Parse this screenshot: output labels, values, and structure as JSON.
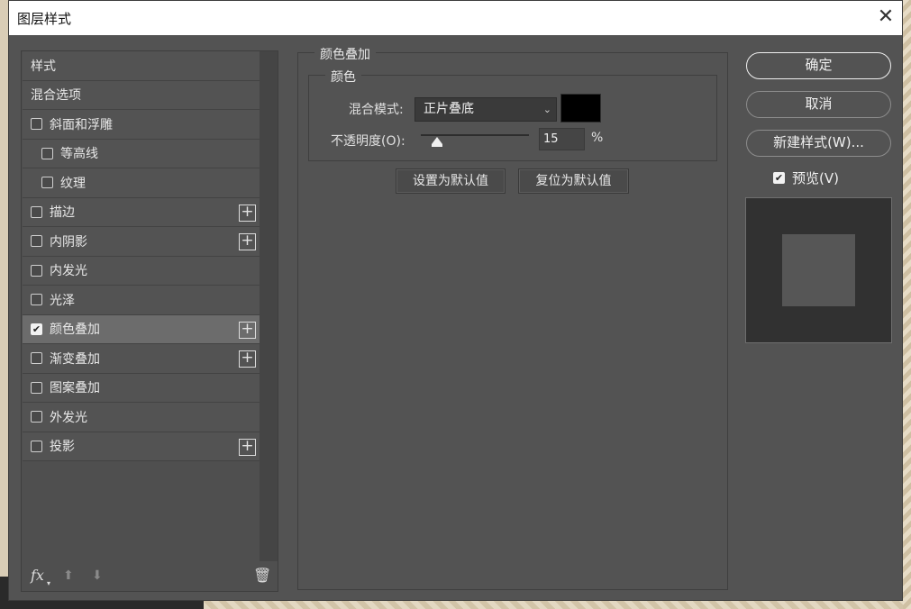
{
  "window": {
    "title": "图层样式",
    "close_glyph": "✕"
  },
  "style_list": [
    {
      "label": "样式",
      "checkbox": false,
      "level": 0,
      "plus": false,
      "active": false
    },
    {
      "label": "混合选项",
      "checkbox": false,
      "level": 0,
      "plus": false,
      "active": false
    },
    {
      "label": "斜面和浮雕",
      "checkbox": true,
      "checked": false,
      "level": 0,
      "plus": false,
      "active": false
    },
    {
      "label": "等高线",
      "checkbox": true,
      "checked": false,
      "level": 1,
      "plus": false,
      "active": false
    },
    {
      "label": "纹理",
      "checkbox": true,
      "checked": false,
      "level": 1,
      "plus": false,
      "active": false
    },
    {
      "label": "描边",
      "checkbox": true,
      "checked": false,
      "level": 0,
      "plus": true,
      "active": false
    },
    {
      "label": "内阴影",
      "checkbox": true,
      "checked": false,
      "level": 0,
      "plus": true,
      "active": false
    },
    {
      "label": "内发光",
      "checkbox": true,
      "checked": false,
      "level": 0,
      "plus": false,
      "active": false
    },
    {
      "label": "光泽",
      "checkbox": true,
      "checked": false,
      "level": 0,
      "plus": false,
      "active": false
    },
    {
      "label": "颜色叠加",
      "checkbox": true,
      "checked": true,
      "level": 0,
      "plus": true,
      "active": true
    },
    {
      "label": "渐变叠加",
      "checkbox": true,
      "checked": false,
      "level": 0,
      "plus": true,
      "active": false
    },
    {
      "label": "图案叠加",
      "checkbox": true,
      "checked": false,
      "level": 0,
      "plus": false,
      "active": false
    },
    {
      "label": "外发光",
      "checkbox": true,
      "checked": false,
      "level": 0,
      "plus": false,
      "active": false
    },
    {
      "label": "投影",
      "checkbox": true,
      "checked": false,
      "level": 0,
      "plus": true,
      "active": false
    }
  ],
  "style_footer": {
    "fx_label": "fx",
    "fx_caret": "▾",
    "up_glyph": "⬆",
    "down_glyph": "⬇",
    "trash_glyph": "🗑"
  },
  "color_overlay": {
    "group_title": "颜色叠加",
    "sub_title": "颜色",
    "blend_mode_label": "混合模式:",
    "blend_mode_value": "正片叠底",
    "chevron": "⌄",
    "swatch_color": "#000000",
    "opacity_label": "不透明度(O):",
    "opacity_value": "15",
    "opacity_fraction": 0.15,
    "percent": "%",
    "set_default": "设置为默认值",
    "reset_default": "复位为默认值"
  },
  "buttons": {
    "ok": "确定",
    "cancel": "取消",
    "new_style": "新建样式(W)..."
  },
  "preview": {
    "label": "预览(V)",
    "checked": true,
    "check_glyph": "✔"
  },
  "colors": {
    "dialog_bg": "#535353",
    "active_item": "#6c6c6c",
    "preview_outer": "#313131",
    "preview_inner": "#565656"
  }
}
